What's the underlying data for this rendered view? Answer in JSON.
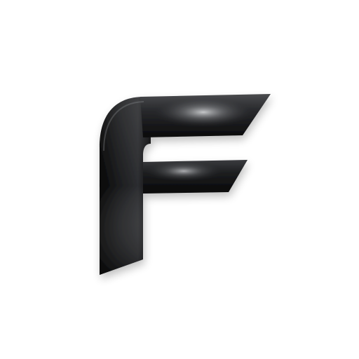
{
  "logo": {
    "icon": "letter-f-logo-icon",
    "letter": "F",
    "colors": {
      "background": "#ffffff",
      "dark": "#0b0b0c",
      "mid": "#2a2b2e",
      "highlight": "#bfc1c4"
    }
  }
}
